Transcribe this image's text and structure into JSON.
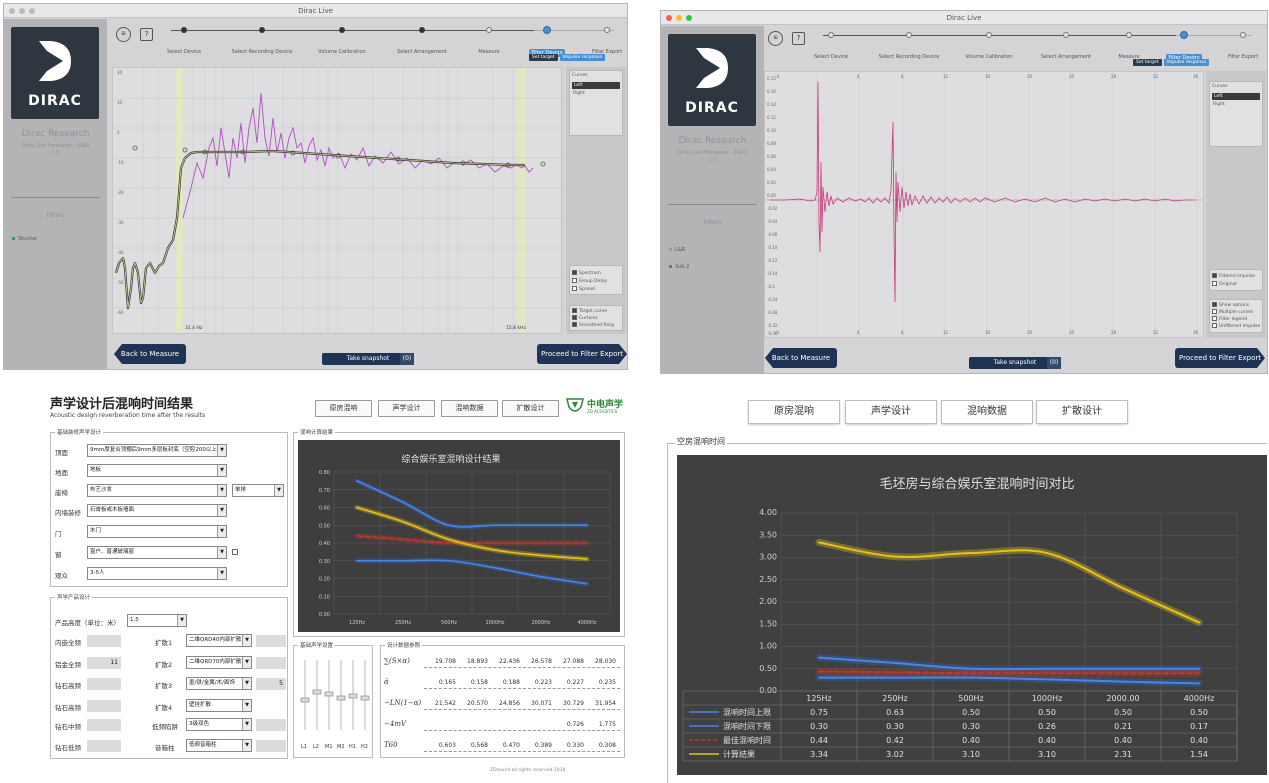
{
  "dirac_left": {
    "window_title": "Dirac Live",
    "logo_text": "DIRAC",
    "company": "Dirac Research",
    "product": "Dirac Live Processor - 9A82",
    "version": "2.0",
    "filters_label": "Filters",
    "sidebar_item": "Stucher",
    "steps": [
      "Select Device",
      "Select Recording Device",
      "Volume Calibration",
      "Select Arrangement",
      "Measure",
      "Filter Design",
      "Filter Export"
    ],
    "active_step": "Filter Design",
    "sub_buttons": [
      "Set target",
      "Impulse response"
    ],
    "top_icons": [
      "⊞",
      "?"
    ],
    "channels_title": "Curves",
    "channels": [
      "Left",
      "Right"
    ],
    "opt_left": [
      "Spectrum",
      "Group Delay",
      "Spread"
    ],
    "opt_right": [
      "Target curve",
      "Curtains",
      "Smoothed Resp"
    ],
    "freq_low_label": "31.4 Hz",
    "freq_high_label": "15.8 kHz",
    "back_button": "Back to Measure",
    "snapshot_button": "Take snapshot",
    "snapshot_count": "(0)",
    "proceed_button": "Proceed to Filter Export"
  },
  "dirac_right": {
    "window_title": "Dirac Live",
    "logo_text": "DIRAC",
    "company": "Dirac Research",
    "product": "Dirac Live Processor - 9A2D",
    "version": "2.0",
    "filters_label": "Filters",
    "sidebar_items": [
      "L&R",
      "Sub 2"
    ],
    "steps": [
      "Select Device",
      "Select Recording Device",
      "Volume Calibration",
      "Select Arrangement",
      "Measure",
      "Filter Design",
      "Filter Export"
    ],
    "active_step": "Filter Design",
    "sub_buttons": [
      "Set target",
      "Impulse response"
    ],
    "top_icons": [
      "⊞",
      "?"
    ],
    "channels_title": "Curves",
    "channels": [
      "Left",
      "Right"
    ],
    "y_ticks": [
      "0.12",
      "0.10",
      "0.14",
      "0.12",
      "0.10",
      "0.08",
      "0.06",
      "0.04",
      "0.02",
      "0.00",
      "-0.02",
      "-0.04",
      "-0.06",
      "-0.10",
      "-0.12",
      "-0.14",
      "-0.2",
      "-0.24",
      "-0.28",
      "-0.32",
      "-0.36"
    ],
    "x_ticks": [
      "-4",
      "4",
      "8",
      "12",
      "16",
      "20",
      "24",
      "28",
      "32",
      "36"
    ],
    "opt_items": [
      "Filtered impulse",
      "Original"
    ],
    "opt_items2": [
      "Show options",
      "Multiple curves",
      "Filter legend",
      "Unfiltered impulse"
    ],
    "back_button": "Back to Measure",
    "snapshot_button": "Take snapshot",
    "snapshot_count": "(0)",
    "proceed_button": "Proceed to Filter Export"
  },
  "design_panel": {
    "title": "声学设计后混响时间结果",
    "subtitle": "Acoustic design reverberation time after the results",
    "tabs": [
      "原房混响",
      "声学设计",
      "混响数据",
      "扩散设计"
    ],
    "brand_name": "中电声学",
    "brand_sub": "ZD ACOUSTICS",
    "basic_group": "基础装修声学设计",
    "fields": [
      {
        "label": "顶面",
        "value": "9mm厚复合顶棚后9mm多层板封底（空腔200以上）"
      },
      {
        "label": "地面",
        "value": "地板"
      },
      {
        "label": "座椅",
        "value": "布艺沙发"
      },
      {
        "label": "内墙装修",
        "value": "石膏板或木板墙面"
      },
      {
        "label": "门",
        "value": "木门"
      },
      {
        "label": "窗",
        "value": "窗户、普通玻璃窗"
      },
      {
        "label": "观众",
        "value": "3-5人"
      }
    ],
    "seat_extra": "单排",
    "product_group": "声学产品设计",
    "height_label": "产品高度（单位：米）",
    "height_value": "1.5",
    "left_items": [
      {
        "label": "内嵌全频",
        "value": ""
      },
      {
        "label": "铝金全频",
        "value": "11"
      },
      {
        "label": "钻石高频",
        "value": ""
      },
      {
        "label": "钻石高频",
        "value": ""
      },
      {
        "label": "钻石中频",
        "value": ""
      },
      {
        "label": "钻石低频",
        "value": ""
      }
    ],
    "right_items": [
      {
        "label": "扩散1",
        "value": "二维QRD40内部扩散"
      },
      {
        "label": "扩散2",
        "value": "二维QRD70内部扩散"
      },
      {
        "label": "扩散3",
        "value": "墨/铁/金属/木/面饰"
      },
      {
        "label": "扩散4",
        "value": "壁挂扩散"
      },
      {
        "label": "低频陷阱",
        "value": "3级双色"
      },
      {
        "label": "音箱柱",
        "value": "低频音箱柱"
      }
    ],
    "right_item3_num": "5",
    "calc_group": "混响计算结果",
    "eq_group": "基础声学设置",
    "eq_labels": [
      "L1",
      "L2",
      "M1",
      "M2",
      "H1",
      "H2"
    ],
    "params_group": "设计数据参照",
    "param_rows": [
      {
        "sym": "∑(S×α)",
        "values": [
          "19.708",
          "18.893",
          "22.436",
          "26.578",
          "27.088",
          "28.030"
        ]
      },
      {
        "sym": "ᾱ",
        "values": [
          "0.165",
          "0.158",
          "0.188",
          "0.223",
          "0.227",
          "0.235"
        ]
      },
      {
        "sym": "−LN(1−α)",
        "values": [
          "21.542",
          "20.570",
          "24.856",
          "30.071",
          "30.729",
          "31.954"
        ]
      },
      {
        "sym": "−4mV",
        "values": [
          "",
          "",
          "",
          "",
          "0.726",
          "1.775"
        ]
      },
      {
        "sym": "T60",
        "values": [
          "0.603",
          "0.568",
          "0.470",
          "0.389",
          "0.330",
          "0.308"
        ]
      }
    ],
    "copyright": "ZDsound all rights reserved 2018"
  },
  "compare_panel": {
    "tabs": [
      "原房混响",
      "声学设计",
      "混响数据",
      "扩散设计"
    ],
    "group_title": "空房混响时间"
  },
  "chart_data": [
    {
      "type": "line",
      "title": "综合娱乐室混响设计结果",
      "categories": [
        "125Hz",
        "250Hz",
        "500Hz",
        "1000Hz",
        "2000Hz",
        "4000Hz"
      ],
      "ylim": [
        0,
        0.8
      ],
      "yticks": [
        "0.80",
        "0.70",
        "0.60",
        "0.50",
        "0.40",
        "0.30",
        "0.20",
        "0.10",
        "0.00"
      ],
      "series": [
        {
          "name": "",
          "color": "#2f66c9",
          "values": [
            0.75,
            0.63,
            0.5,
            0.5,
            0.5,
            0.5
          ]
        },
        {
          "name": "",
          "color": "#2f66c9",
          "values": [
            0.3,
            0.3,
            0.3,
            0.26,
            0.21,
            0.17
          ]
        },
        {
          "name": "",
          "color": "#c0392b",
          "dashed": true,
          "values": [
            0.44,
            0.42,
            0.4,
            0.4,
            0.4,
            0.4
          ]
        },
        {
          "name": "",
          "color": "#e6c21a",
          "values": [
            0.6,
            0.52,
            0.42,
            0.36,
            0.33,
            0.31
          ]
        }
      ]
    },
    {
      "type": "line",
      "title": "毛坯房与综合娱乐室混响时间对比",
      "categories": [
        "125Hz",
        "250Hz",
        "500Hz",
        "1000Hz",
        "2000.00",
        "4000Hz"
      ],
      "ylim": [
        0,
        4
      ],
      "yticks": [
        "4.00",
        "3.50",
        "3.00",
        "2.50",
        "2.00",
        "1.50",
        "1.00",
        "0.50",
        "0.00"
      ],
      "table": true,
      "series": [
        {
          "name": "混响时间上限",
          "color": "#2f66c9",
          "values": [
            0.75,
            0.63,
            0.5,
            0.5,
            0.5,
            0.5
          ]
        },
        {
          "name": "混响时间下限",
          "color": "#2f66c9",
          "values": [
            0.3,
            0.3,
            0.3,
            0.26,
            0.21,
            0.17
          ]
        },
        {
          "name": "最佳混响时间",
          "color": "#c0392b",
          "dashed": true,
          "values": [
            0.44,
            0.42,
            0.4,
            0.4,
            0.4,
            0.4
          ]
        },
        {
          "name": "计算结果",
          "color": "#e6c21a",
          "values": [
            3.34,
            3.02,
            3.1,
            3.1,
            2.31,
            1.54
          ]
        }
      ],
      "table_rows": [
        [
          "0.75",
          "0.63",
          "0.50",
          "0.50",
          "0.50",
          "0.50"
        ],
        [
          "0.30",
          "0.30",
          "0.30",
          "0.26",
          "0.21",
          "0.17"
        ],
        [
          "0.44",
          "0.42",
          "0.40",
          "0.40",
          "0.40",
          "0.40"
        ],
        [
          "3.34",
          "3.02",
          "3.10",
          "3.10",
          "2.31",
          "1.54"
        ]
      ]
    }
  ]
}
